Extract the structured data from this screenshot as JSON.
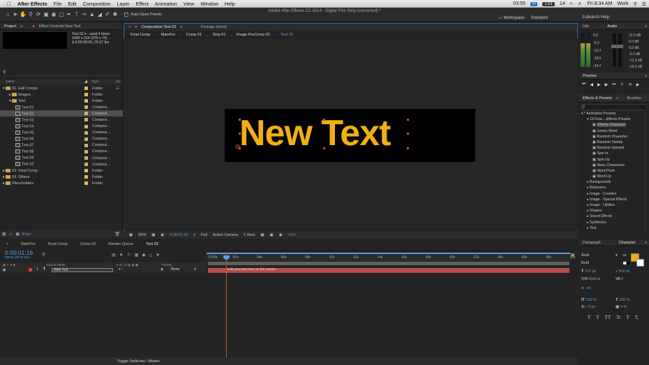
{
  "menubar": {
    "app": "After Effects",
    "items": [
      "File",
      "Edit",
      "Composition",
      "Layer",
      "Effect",
      "Animation",
      "View",
      "Window",
      "Help"
    ],
    "window_title": "Adobe After Effects CC 2014 - Digital Film Strip (converted) *",
    "clock_small": "03:55",
    "badge": "H",
    "badge2": "1:51",
    "count": "14",
    "time": "Fri 8:34 AM",
    "user": "Work"
  },
  "toolbar": {
    "auto_open": "Auto-Open Panels",
    "workspace_label": "Workspace:",
    "workspace_value": "Standard",
    "search_help": "Search Help"
  },
  "project": {
    "tabs": [
      "Project",
      "Effect Controls New Text"
    ],
    "info_line1": "Text 02 ▾ , used 4 times",
    "info_line2": "1480 x 314  (370 x 79) ...",
    "info_line3": "Δ 0:00:30:00, 29.97 fps",
    "col_name": "Name",
    "col_type": "Type",
    "col_size": "Siz",
    "items": [
      {
        "name": "01. Edit Comps",
        "type": "Folder",
        "indent": 0,
        "kind": "folder",
        "color": "#d8c04a"
      },
      {
        "name": "Images",
        "type": "Folder",
        "indent": 1,
        "kind": "folder",
        "color": "#d8c04a"
      },
      {
        "name": "Text",
        "type": "Folder",
        "indent": 1,
        "kind": "folder",
        "color": "#d8c04a"
      },
      {
        "name": "Text 01",
        "type": "Composi...",
        "indent": 2,
        "kind": "comp",
        "color": "#c7b16e"
      },
      {
        "name": "Text 02",
        "type": "Composi...",
        "indent": 2,
        "kind": "comp",
        "color": "#c7b16e",
        "selected": true
      },
      {
        "name": "Text 03",
        "type": "Composi...",
        "indent": 2,
        "kind": "comp",
        "color": "#c7b16e"
      },
      {
        "name": "Text 04",
        "type": "Composi...",
        "indent": 2,
        "kind": "comp",
        "color": "#c7b16e"
      },
      {
        "name": "Text 05",
        "type": "Composi...",
        "indent": 2,
        "kind": "comp",
        "color": "#c7b16e"
      },
      {
        "name": "Text 06",
        "type": "Composi...",
        "indent": 2,
        "kind": "comp",
        "color": "#c7b16e"
      },
      {
        "name": "Text 07",
        "type": "Composi...",
        "indent": 2,
        "kind": "comp",
        "color": "#c7b16e"
      },
      {
        "name": "Text 08",
        "type": "Composi...",
        "indent": 2,
        "kind": "comp",
        "color": "#c7b16e"
      },
      {
        "name": "Text 09",
        "type": "Composi...",
        "indent": 2,
        "kind": "comp",
        "color": "#c7b16e"
      },
      {
        "name": "Text 10",
        "type": "Composi...",
        "indent": 2,
        "kind": "comp",
        "color": "#c7b16e"
      },
      {
        "name": "02. Final Comp",
        "type": "Folder",
        "indent": 0,
        "kind": "folder",
        "color": "#d8c04a"
      },
      {
        "name": "03. Others",
        "type": "Folder",
        "indent": 0,
        "kind": "folder",
        "color": "#d8c04a"
      },
      {
        "name": "Placeholders",
        "type": "Folder",
        "indent": 0,
        "kind": "folder",
        "color": "#d8c04a"
      }
    ],
    "bpc": "8 bpc"
  },
  "composition": {
    "panel_tab": "Composition Text 02",
    "footage_tab": "Footage (none)",
    "breadcrumbs": [
      "Final Comp",
      "MainPre",
      "Comp 01",
      "Strip 01",
      "Image PreComp 03",
      "Text 02"
    ],
    "canvas_text": "New Text",
    "text_color": "#f1b00f",
    "zoom": "50%",
    "timecode": "0:00:01:16",
    "resolution": "Full",
    "camera": "Active Camera",
    "views": "1 View",
    "exposure": "+0.0"
  },
  "info_audio": {
    "tabs": [
      "Info",
      "Audio"
    ],
    "left_db": [
      "0.0",
      "-6.0",
      "-12.0",
      "-18.0",
      "-24.0"
    ],
    "right_db": [
      "12.0 dB",
      "6.0 dB",
      "0.0 dB",
      "-6.0 dB",
      "-12.0 dB",
      "-18.0 dB"
    ],
    "level": 0.7
  },
  "preview": {
    "title": "Preview"
  },
  "effects": {
    "tabs": [
      "Effects & Presets",
      "Brushes"
    ],
    "search_placeholder": "",
    "items": [
      {
        "name": "* Animation Presets",
        "indent": 0
      },
      {
        "name": "10 Free....Effects Presets",
        "indent": 1
      },
      {
        "name": "Glitchy Character",
        "indent": 2,
        "selected": true
      },
      {
        "name": "Jumpy Word",
        "indent": 2
      },
      {
        "name": "Random Character",
        "indent": 2
      },
      {
        "name": "Random Sweep",
        "indent": 2
      },
      {
        "name": "Random Upward",
        "indent": 2
      },
      {
        "name": "Spin In",
        "indent": 2
      },
      {
        "name": "Spin Up",
        "indent": 2
      },
      {
        "name": "Wavy Characters",
        "indent": 2
      },
      {
        "name": "Word Push",
        "indent": 2
      },
      {
        "name": "Word Up",
        "indent": 2
      },
      {
        "name": "Backgrounds",
        "indent": 1
      },
      {
        "name": "Behaviors",
        "indent": 1
      },
      {
        "name": "Image - Creative",
        "indent": 1
      },
      {
        "name": "Image - Special Effects",
        "indent": 1
      },
      {
        "name": "Image - Utilities",
        "indent": 1
      },
      {
        "name": "Shapes",
        "indent": 1
      },
      {
        "name": "Sound Effects",
        "indent": 1
      },
      {
        "name": "Synthetics",
        "indent": 1
      },
      {
        "name": "Text",
        "indent": 1
      }
    ]
  },
  "timeline": {
    "tabs": [
      "MainPre",
      "Final Comp",
      "Comp 03",
      "Render Queue",
      "Text 02"
    ],
    "timecode": "0:00:01:16",
    "frames": "00046 (29.97 fps)",
    "col_source": "Source Name",
    "col_parent": "Parent",
    "layer_num": "1",
    "layer_name": "New Text",
    "parent_value": "None",
    "ruler_labels": [
      "0:00s",
      "02s",
      "04s",
      "06s",
      "08s",
      "10s",
      "12s",
      "14s",
      "16s",
      "18s",
      "20s",
      "22s",
      "24s",
      "26s",
      "28s",
      "30s"
    ],
    "marker_text": "Edit your text here at this marker",
    "toggle_label": "Toggle Switches / Modes"
  },
  "character": {
    "tabs": [
      "Paragraph",
      "Character"
    ],
    "font": "Arial",
    "style": "Bold",
    "size": "121 px",
    "leading": "202 px",
    "kerning": "Optical",
    "tracking": "0",
    "stroke": "- px",
    "vscale": "100 %",
    "hscale": "100 %",
    "baseline": "-2 px",
    "tsume": "0 %",
    "fill_color": "#f5a900",
    "type_buttons": [
      "T",
      "T",
      "TT",
      "Tr",
      "T",
      "T,"
    ]
  }
}
